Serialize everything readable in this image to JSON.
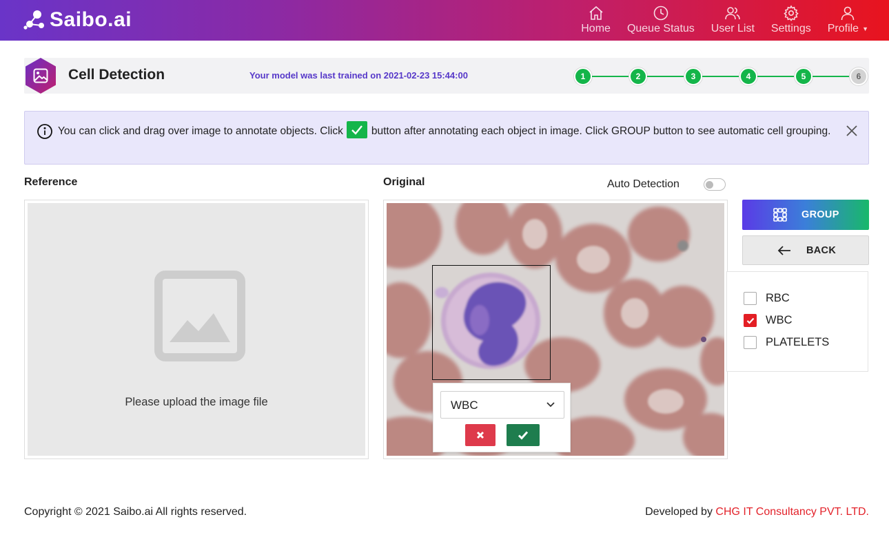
{
  "brand": {
    "name": "Saibo.ai"
  },
  "nav": {
    "items": [
      {
        "label": "Home",
        "icon": "home-icon"
      },
      {
        "label": "Queue Status",
        "icon": "clock-icon"
      },
      {
        "label": "User List",
        "icon": "users-icon"
      },
      {
        "label": "Settings",
        "icon": "gear-icon"
      },
      {
        "label": "Profile",
        "icon": "user-icon"
      }
    ]
  },
  "header": {
    "title": "Cell Detection",
    "trained_text": "Your model was last trained on 2021-02-23 15:44:00",
    "steps": [
      "1",
      "2",
      "3",
      "4",
      "5",
      "6"
    ],
    "completed_steps": 5
  },
  "banner": {
    "text_before": "You can click and drag over image to annotate objects. Click",
    "text_after": "button after annotating each object in image. Click GROUP button to see automatic cell grouping."
  },
  "reference": {
    "label": "Reference",
    "placeholder": "Please upload the image file"
  },
  "original": {
    "label": "Original",
    "auto_detection_label": "Auto Detection",
    "auto_detection_on": false
  },
  "annotation": {
    "selected_class": "WBC"
  },
  "actions": {
    "group_label": "GROUP",
    "back_label": "BACK"
  },
  "classes": [
    {
      "label": "RBC",
      "checked": false
    },
    {
      "label": "WBC",
      "checked": true
    },
    {
      "label": "PLATELETS",
      "checked": false
    }
  ],
  "footer": {
    "copyright": "Copyright © 2021 Saibo.ai All rights reserved.",
    "developed_prefix": "Developed by ",
    "developer": "CHG IT Consultancy PVT. LTD."
  },
  "colors": {
    "accent_green": "#14b54a",
    "title_purple": "#5638c9",
    "brand_red": "#e3222a"
  }
}
